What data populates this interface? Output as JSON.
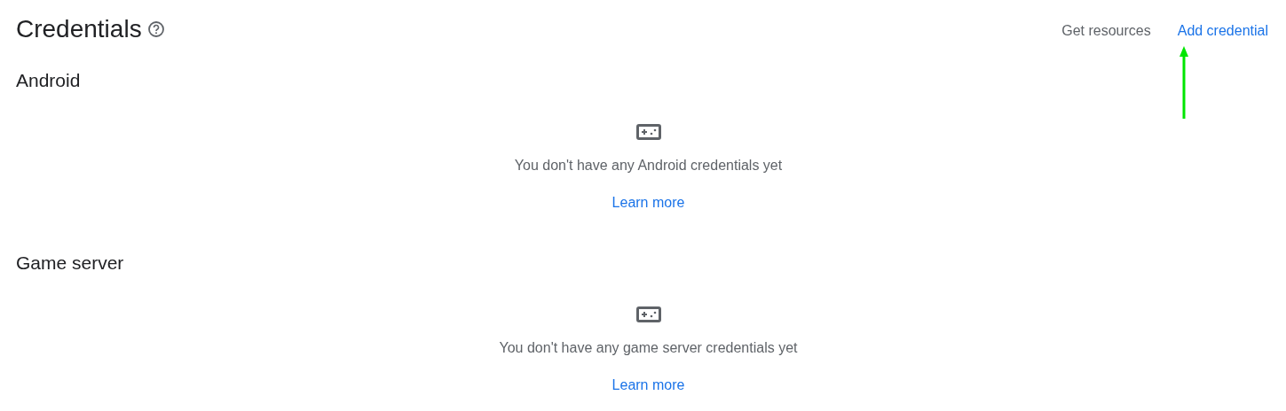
{
  "page": {
    "title": "Credentials",
    "help_icon": true
  },
  "actions": [
    {
      "label": "Get resources",
      "kind": "secondary"
    },
    {
      "label": "Add credential",
      "kind": "primary"
    }
  ],
  "sections": [
    {
      "heading": "Android",
      "empty_message": "You don't have any Android credentials yet",
      "link": "Learn more"
    },
    {
      "heading": "Game server",
      "empty_message": "You don't have any game server credentials yet",
      "link": "Learn more"
    }
  ]
}
